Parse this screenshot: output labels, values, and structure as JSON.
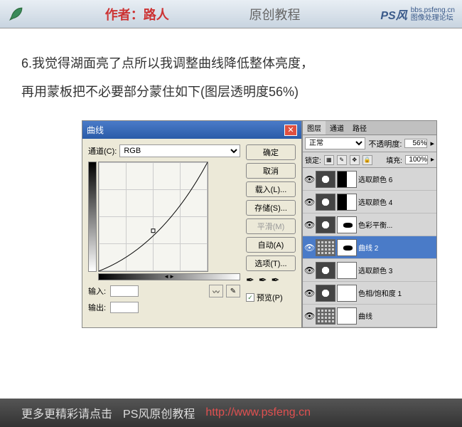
{
  "header": {
    "author_label": "作者：路人",
    "tutorial_label": "原创教程",
    "logo_text": "PS风",
    "logo_url": "bbs.psfeng.cn",
    "logo_sub": "图像处理论坛"
  },
  "instruction": {
    "line1": "6.我觉得湖面亮了点所以我调整曲线降低整体亮度，",
    "line2": "再用蒙板把不必要部分蒙住如下(图层透明度56%)"
  },
  "curves": {
    "title": "曲线",
    "channel_label": "通道(C):",
    "channel_value": "RGB",
    "input_label": "输入:",
    "output_label": "输出:",
    "buttons": {
      "ok": "确定",
      "cancel": "取消",
      "load": "载入(L)...",
      "save": "存储(S)...",
      "smooth": "平滑(M)",
      "auto": "自动(A)",
      "options": "选项(T)..."
    },
    "preview_label": "预览(P)"
  },
  "layers": {
    "tabs": [
      "图层",
      "通道",
      "路径"
    ],
    "blend_mode": "正常",
    "opacity_label": "不透明度:",
    "opacity_value": "56%",
    "lock_label": "锁定:",
    "fill_label": "填充:",
    "fill_value": "100%",
    "items": [
      {
        "name": "选取颜色 6",
        "selected": false,
        "adj": true
      },
      {
        "name": "选取颜色 4",
        "selected": false,
        "adj": true
      },
      {
        "name": "色彩平衡...",
        "selected": false,
        "adj": true
      },
      {
        "name": "曲线 2",
        "selected": true,
        "adj": false,
        "grid": true
      },
      {
        "name": "选取颜色 3",
        "selected": false,
        "adj": true
      },
      {
        "name": "色相/饱和度 1",
        "selected": false,
        "adj": true
      },
      {
        "name": "曲线",
        "selected": false,
        "adj": false,
        "grid": true
      }
    ]
  },
  "footer": {
    "text1": "更多更精彩请点击",
    "text2": "PS风原创教程",
    "link": "http://www.psfeng.cn"
  }
}
